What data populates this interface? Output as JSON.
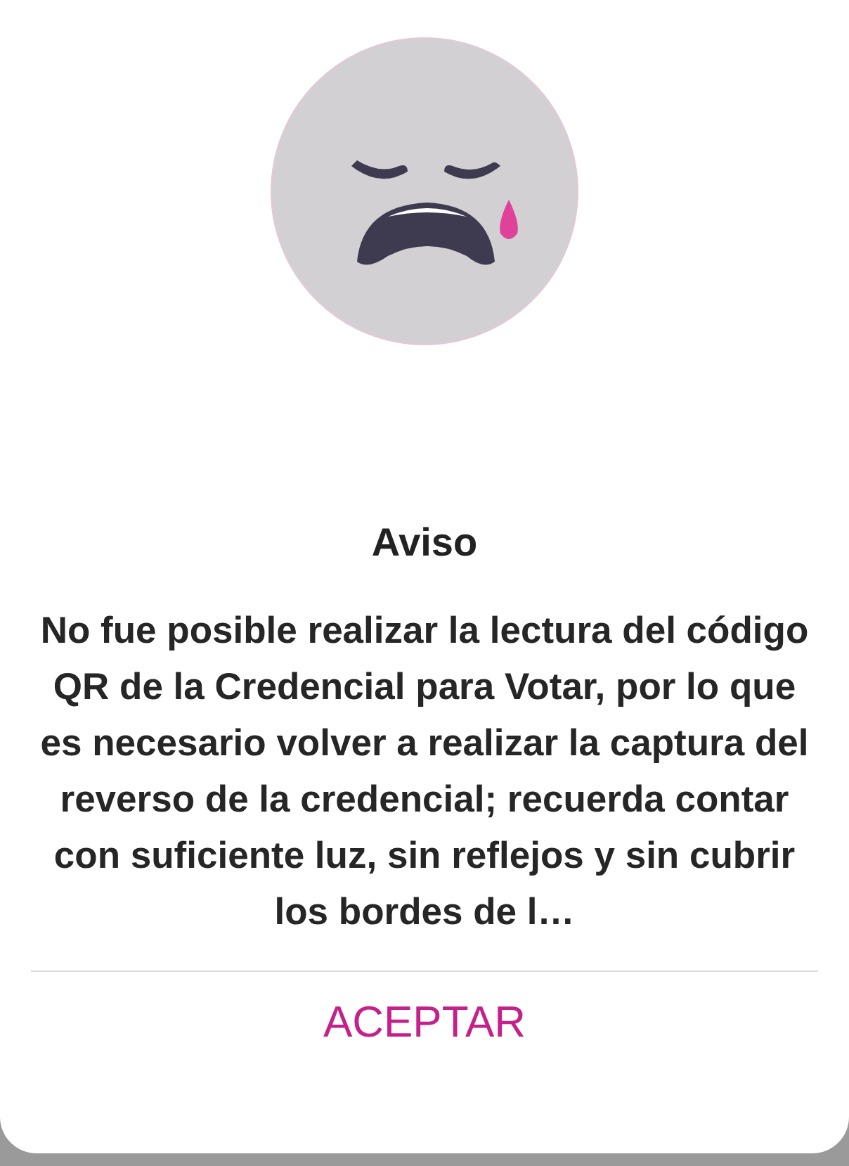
{
  "dialog": {
    "title": "Aviso",
    "message": "No fue posible realizar la lectura del código QR de la Credencial para Votar, por lo que es necesario volver a realizar la captura del reverso de la credencial; recuerda contar con suficiente luz, sin reflejos y sin cubrir los bordes de l…",
    "buttons": [
      "ACEPTAR"
    ]
  }
}
